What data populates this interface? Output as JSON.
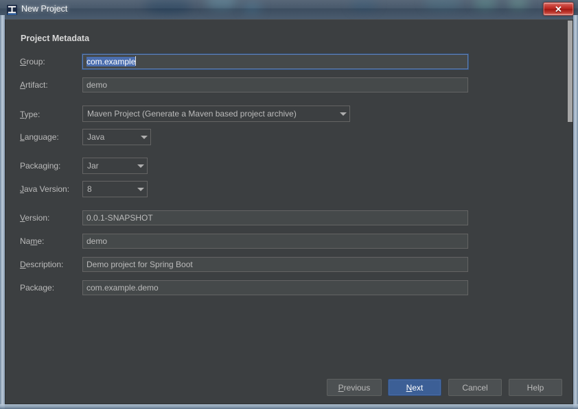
{
  "window": {
    "title": "New Project",
    "icon": "intellij-idea-icon",
    "close_label": "✕",
    "accent_default_button": "#3c5f96",
    "selection_color": "#4b6eaf",
    "dialog_background": "#3c3f41",
    "field_background": "#45494a"
  },
  "form": {
    "section_title": "Project Metadata",
    "fields": {
      "group": {
        "label_pre": "",
        "label_mnemonic": "G",
        "label_post": "roup:",
        "value": "com.example",
        "selected": true
      },
      "artifact": {
        "label_pre": "",
        "label_mnemonic": "A",
        "label_post": "rtifact:",
        "value": "demo"
      },
      "type": {
        "label_pre": "",
        "label_mnemonic": "T",
        "label_post": "ype:",
        "value": "Maven Project (Generate a Maven based project archive)"
      },
      "language": {
        "label_pre": "",
        "label_mnemonic": "L",
        "label_post": "anguage:",
        "value": "Java"
      },
      "packaging": {
        "label_pre": "Packa",
        "label_mnemonic": "g",
        "label_post": "ing:",
        "value": "Jar"
      },
      "java_version": {
        "label_pre": "",
        "label_mnemonic": "J",
        "label_post": "ava Version:",
        "value": "8"
      },
      "version": {
        "label_pre": "",
        "label_mnemonic": "V",
        "label_post": "ersion:",
        "value": "0.0.1-SNAPSHOT"
      },
      "name": {
        "label_pre": "Na",
        "label_mnemonic": "m",
        "label_post": "e:",
        "value": "demo"
      },
      "description": {
        "label_pre": "",
        "label_mnemonic": "D",
        "label_post": "escription:",
        "value": "Demo project for Spring Boot"
      },
      "package": {
        "label_pre": "Package:",
        "label_mnemonic": "",
        "label_post": "",
        "value": "com.example.demo"
      }
    }
  },
  "buttons": {
    "previous": {
      "pre": "",
      "mnemonic": "P",
      "post": "revious"
    },
    "next": {
      "pre": "",
      "mnemonic": "N",
      "post": "ext",
      "default": true
    },
    "cancel": {
      "pre": "Cancel",
      "mnemonic": "",
      "post": ""
    },
    "help": {
      "pre": "Help",
      "mnemonic": "",
      "post": ""
    }
  },
  "scrollbar": {
    "thumb_top": 1,
    "thumb_height": 148
  }
}
